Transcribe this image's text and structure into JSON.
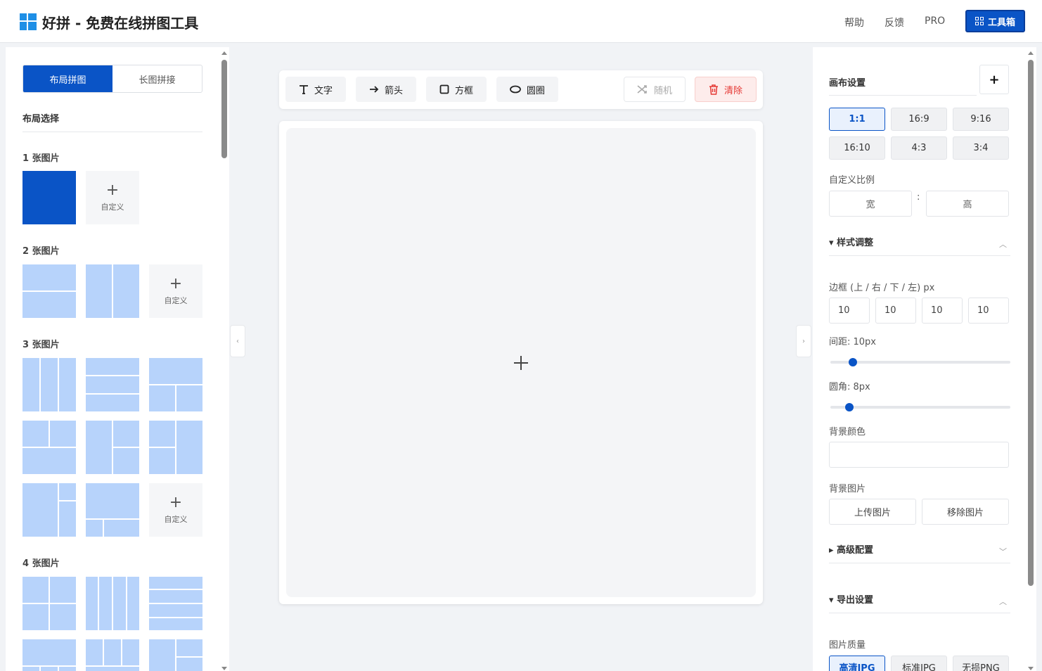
{
  "header": {
    "title": "好拼 - 免费在线拼图工具",
    "nav": [
      "帮助",
      "反馈",
      "PRO"
    ],
    "toolbox_label": "工具箱"
  },
  "left": {
    "tabs": [
      "布局拼图",
      "长图拼接"
    ],
    "active_tab": 0,
    "section_title": "布局选择",
    "groups": [
      "1 张图片",
      "2 张图片",
      "3 张图片",
      "4 张图片"
    ],
    "custom_label": "自定义"
  },
  "toolbar": {
    "text": "文字",
    "arrow": "箭头",
    "box": "方框",
    "circle": "圆圈",
    "random": "随机",
    "clear": "清除"
  },
  "right": {
    "canvas_title": "画布设置",
    "pin_icon": "+",
    "ratios": [
      "1:1",
      "16:9",
      "9:16",
      "16:10",
      "4:3",
      "3:4"
    ],
    "active_ratio": "1:1",
    "custom_ratio_label": "自定义比例",
    "width_placeholder": "宽",
    "height_placeholder": "高",
    "ratio_separator": ":",
    "style_title": "▾ 样式调整",
    "border_label": "边框 (上 / 右 / 下 / 左) px",
    "borders": [
      "10",
      "10",
      "10",
      "10"
    ],
    "spacing_label": "间距: 10px",
    "spacing_value": 10,
    "radius_label": "圆角: 8px",
    "radius_value": 8,
    "bg_color_label": "背景颜色",
    "bg_image_label": "背景图片",
    "upload_label": "上传图片",
    "remove_label": "移除图片",
    "advanced_title": "▸ 高级配置",
    "export_title": "▾ 导出设置",
    "quality_label": "图片质量",
    "quality_options": [
      "高清JPG",
      "标准JPG",
      "无损PNG"
    ]
  },
  "colors": {
    "primary": "#0a54c6",
    "cell": "#b7d3fb",
    "danger": "#e53935"
  }
}
